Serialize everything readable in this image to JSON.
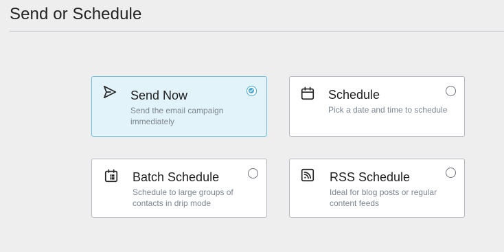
{
  "page": {
    "title": "Send or Schedule"
  },
  "options": [
    {
      "id": "send-now",
      "title": "Send Now",
      "description": "Send the email campaign immediately",
      "icon": "paper-plane-icon",
      "selected": true
    },
    {
      "id": "schedule",
      "title": "Schedule",
      "description": "Pick a date and time to schedule",
      "icon": "calendar-icon",
      "selected": false
    },
    {
      "id": "batch-schedule",
      "title": "Batch Schedule",
      "description": "Schedule to large groups of contacts in drip mode",
      "icon": "batch-calendar-icon",
      "selected": false
    },
    {
      "id": "rss-schedule",
      "title": "RSS Schedule",
      "description": "Ideal for blog posts or regular content feeds",
      "icon": "rss-icon",
      "selected": false
    }
  ],
  "colors": {
    "background": "#eeeeee",
    "selected_card_bg": "#e3f3fa",
    "selected_border": "#6cbfdc",
    "radio_accent": "#47a8d3",
    "description_text": "#7c8591"
  }
}
